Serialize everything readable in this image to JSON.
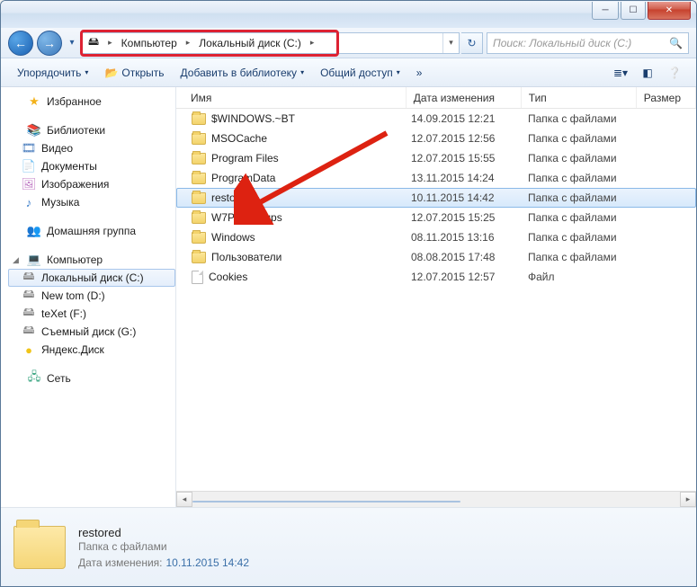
{
  "titlebar": {
    "min_glyph": "─",
    "max_glyph": "☐",
    "close_glyph": "✕"
  },
  "nav": {
    "back_glyph": "←",
    "fwd_glyph": "→",
    "dd_glyph": "▾",
    "refresh_glyph": "↻",
    "computer": "Компьютер",
    "drive": "Локальный диск (C:)",
    "path_sep": "▸"
  },
  "search": {
    "placeholder": "Поиск: Локальный диск (C:)",
    "mag": "🔍"
  },
  "toolbar": {
    "organize": "Упорядочить",
    "open": "Открыть",
    "add_lib": "Добавить в библиотеку",
    "share": "Общий доступ",
    "dd": "▾",
    "open_icon": "📂"
  },
  "navpane": {
    "fav": "Избранное",
    "lib": "Библиотеки",
    "lib_items": {
      "video": "Видео",
      "docs": "Документы",
      "pics": "Изображения",
      "music": "Музыка"
    },
    "home": "Домашняя группа",
    "comp": "Компьютер",
    "drives": {
      "c": "Локальный диск (C:)",
      "d": "New tom (D:)",
      "f": "teXet (F:)",
      "g": "Съемный диск (G:)",
      "y": "Яндекс.Диск"
    },
    "net": "Сеть",
    "exp_open": "◢",
    "exp_closed": "▷"
  },
  "columns": {
    "name": "Имя",
    "date": "Дата изменения",
    "type": "Тип",
    "size": "Размер"
  },
  "files": [
    {
      "name": "$WINDOWS.~BT",
      "date": "14.09.2015 12:21",
      "type": "Папка с файлами",
      "icon": "folder"
    },
    {
      "name": "MSOCache",
      "date": "12.07.2015 12:56",
      "type": "Папка с файлами",
      "icon": "folder"
    },
    {
      "name": "Program Files",
      "date": "12.07.2015 15:55",
      "type": "Папка с файлами",
      "icon": "folder"
    },
    {
      "name": "ProgramData",
      "date": "13.11.2015 14:24",
      "type": "Папка с файлами",
      "icon": "folder"
    },
    {
      "name": "restored",
      "date": "10.11.2015 14:42",
      "type": "Папка с файлами",
      "icon": "folder",
      "selected": true
    },
    {
      "name": "W7P_Backups",
      "date": "12.07.2015 15:25",
      "type": "Папка с файлами",
      "icon": "folder"
    },
    {
      "name": "Windows",
      "date": "08.11.2015 13:16",
      "type": "Папка с файлами",
      "icon": "folder"
    },
    {
      "name": "Пользователи",
      "date": "08.08.2015 17:48",
      "type": "Папка с файлами",
      "icon": "folder"
    },
    {
      "name": "Cookies",
      "date": "12.07.2015 12:57",
      "type": "Файл",
      "icon": "file"
    }
  ],
  "details": {
    "name": "restored",
    "type": "Папка с файлами",
    "date_label": "Дата изменения:",
    "date_value": "10.11.2015 14:42"
  }
}
